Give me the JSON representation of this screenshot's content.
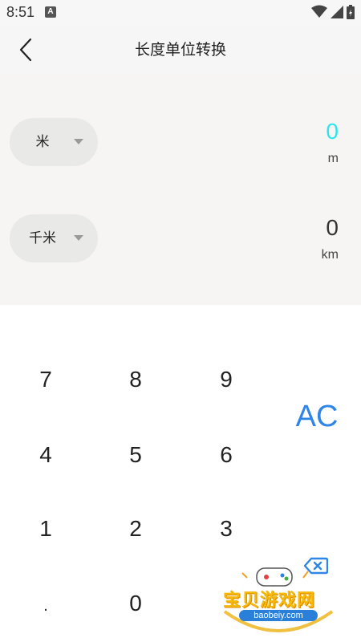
{
  "status_bar": {
    "time": "8:51",
    "notification_icon_letter": "A",
    "icons": [
      "wifi-icon",
      "signal-icon",
      "battery-icon"
    ]
  },
  "app_bar": {
    "title": "长度单位转换",
    "back_icon": "chevron-left-icon"
  },
  "converter": {
    "from": {
      "unit_name": "米",
      "value": "0",
      "unit_symbol": "m",
      "active_color": "#2ee6ea"
    },
    "to": {
      "unit_name": "千米",
      "value": "0",
      "unit_symbol": "km"
    }
  },
  "keypad": {
    "keys": [
      "7",
      "8",
      "9",
      "4",
      "5",
      "6",
      "1",
      "2",
      "3",
      ".",
      "0"
    ],
    "clear_label": "AC",
    "clear_color": "#2f86e6",
    "backspace_icon": "backspace-icon"
  },
  "watermark": {
    "text": "宝贝游戏网",
    "url": "baobeiy.com"
  }
}
